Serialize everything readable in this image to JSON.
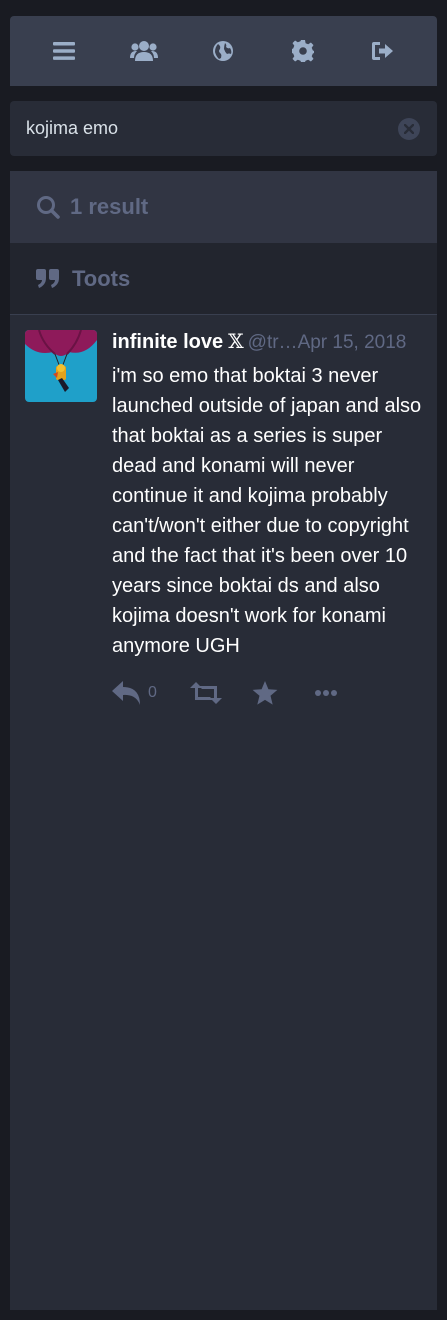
{
  "nav": {
    "items": [
      {
        "icon": "bars-icon"
      },
      {
        "icon": "users-icon"
      },
      {
        "icon": "globe-icon"
      },
      {
        "icon": "gear-icon"
      },
      {
        "icon": "sign-out-icon"
      }
    ]
  },
  "search": {
    "value": "kojima emo",
    "clear_icon": "clear-circle-icon"
  },
  "results": {
    "summary": "1 result",
    "section_label": "Toots"
  },
  "status": {
    "display_name": "infinite love",
    "verified_mark": "𝕏",
    "acct": "@tr…",
    "timestamp": "Apr 15, 2018",
    "content": "i'm so emo that boktai 3 never launched outside of japan and also that boktai as a series is super dead and konami will never continue it and kojima probably can't/won't either due to copyright and the fact that it's been over 10 years since boktai ds and also kojima doesn't work for konami anymore UGH",
    "reply_count": "0"
  },
  "colors": {
    "background": "#191b22",
    "panel": "#282c37",
    "nav": "#393f4f",
    "muted": "#606984",
    "icon": "#9baec8"
  }
}
